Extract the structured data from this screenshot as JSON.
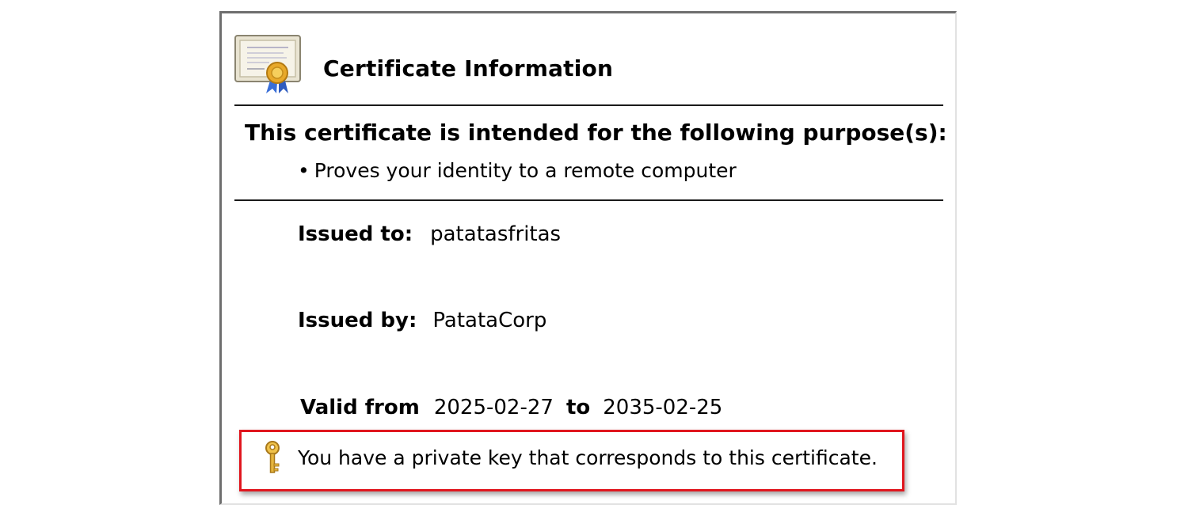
{
  "dialog": {
    "title": "Certificate Information",
    "icon": "certificate-icon"
  },
  "purpose": {
    "heading": "This certificate is intended for the following purpose(s):",
    "bullet": "•",
    "items": [
      "Proves your identity to a remote computer"
    ]
  },
  "fields": {
    "issued_to_label": "Issued to:",
    "issued_to_value": "patatasfritas",
    "issued_by_label": "Issued by:",
    "issued_by_value": "PatataCorp",
    "valid_from_label": "Valid from",
    "valid_from_value": "2025-02-27",
    "valid_to_label": "to",
    "valid_to_value": "2035-02-25"
  },
  "private_key": {
    "icon": "key-icon",
    "message": "You have a private key that corresponds to this certificate.",
    "highlight_color": "#e0161e"
  }
}
